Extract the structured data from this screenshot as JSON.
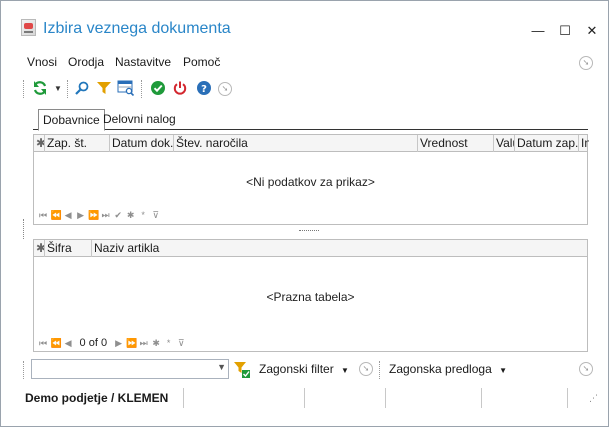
{
  "window": {
    "title": "Izbira veznega dokumenta",
    "controls": {
      "minimize": "—",
      "maximize": "☐",
      "close": "✕"
    }
  },
  "menu": {
    "items": [
      "Vnosi",
      "Orodja",
      "Nastavitve",
      "Pomoč"
    ]
  },
  "toolbar": {
    "icons": [
      "refresh-icon",
      "dropdown-arrow-icon",
      "search-icon",
      "filter-icon",
      "grid-search-icon",
      "confirm-icon",
      "power-icon",
      "help-icon",
      "circle-arrow-icon"
    ],
    "colors": {
      "refresh": "#1f9a3a",
      "search": "#2277bb",
      "filter": "#e2a000",
      "confirm": "#1f9a3a",
      "power": "#d3272f",
      "help": "#2a6fb8",
      "grey": "#9a9a9a"
    }
  },
  "tabs": [
    {
      "label": "Dobavnice",
      "active": true
    },
    {
      "label": "Delovni nalog",
      "active": false
    }
  ],
  "grid_top": {
    "columns": [
      "",
      "Zap. št.",
      "Datum dok.",
      "Štev. naročila",
      "Vrednost",
      "Valu",
      "Datum zap.",
      "In"
    ],
    "empty_text": "<Ni podatkov za prikaz>",
    "nav": [
      "⏮",
      "⏪",
      "◀",
      "▶",
      "⏩",
      "⏭",
      "✔",
      "✱",
      "*",
      "⊽"
    ]
  },
  "grid_bottom": {
    "columns": [
      "",
      "Šifra",
      "Naziv artikla"
    ],
    "empty_text": "<Prazna tabela>",
    "nav": [
      "⏮",
      "⏪",
      "◀"
    ],
    "record_text": "0 of 0",
    "nav_after": [
      "▶",
      "⏩",
      "⏭",
      "✱",
      "*",
      "⊽"
    ]
  },
  "bottom_toolbar": {
    "combo_value": "",
    "filter_label": "Zagonski filter",
    "template_label": "Zagonska predloga"
  },
  "status": {
    "company": "Demo podjetje / KLEMEN"
  }
}
